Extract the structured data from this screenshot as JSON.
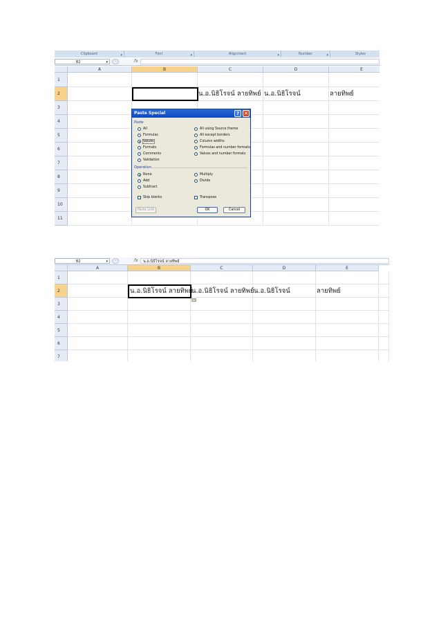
{
  "screenshot1": {
    "ribbon_groups": [
      {
        "label": "Clipboard",
        "launcher": "▾"
      },
      {
        "label": "Font",
        "launcher": "▾"
      },
      {
        "label": "Alignment",
        "launcher": "▾"
      },
      {
        "label": "Number",
        "launcher": "▾"
      },
      {
        "label": "Styles",
        "launcher": ""
      }
    ],
    "name_box": "B2",
    "formula": "",
    "columns": [
      "A",
      "B",
      "C",
      "D",
      "E"
    ],
    "rows": [
      "1",
      "2",
      "3",
      "4",
      "5",
      "6",
      "7",
      "8",
      "9",
      "10",
      "11"
    ],
    "cells": {
      "C2": "น.อ.นิธิโรจน์ ลายทิพย์",
      "D2": "น.อ.นิธิโรจน์",
      "E2": "ลายทิพย์"
    },
    "dialog": {
      "title": "Paste Special",
      "help": "?",
      "close": "✕",
      "paste_label": "Paste",
      "paste_left": [
        {
          "label": "All",
          "selected": false
        },
        {
          "label": "Formulas",
          "selected": false
        },
        {
          "label": "Values",
          "selected": true
        },
        {
          "label": "Formats",
          "selected": false
        },
        {
          "label": "Comments",
          "selected": false
        },
        {
          "label": "Validation",
          "selected": false
        }
      ],
      "paste_right": [
        {
          "label": "All using Source theme",
          "selected": false
        },
        {
          "label": "All except borders",
          "selected": false
        },
        {
          "label": "Column widths",
          "selected": false
        },
        {
          "label": "Formulas and number formats",
          "selected": false
        },
        {
          "label": "Values and number formats",
          "selected": false
        }
      ],
      "operation_label": "Operation",
      "operation_left": [
        {
          "label": "None",
          "selected": true
        },
        {
          "label": "Add",
          "selected": false
        },
        {
          "label": "Subtract",
          "selected": false
        }
      ],
      "operation_right": [
        {
          "label": "Multiply",
          "selected": false
        },
        {
          "label": "Divide",
          "selected": false
        }
      ],
      "skip_blanks": "Skip blanks",
      "transpose": "Transpose",
      "paste_link": "Paste Link",
      "ok": "OK",
      "cancel": "Cancel"
    }
  },
  "screenshot2": {
    "name_box": "B2",
    "formula": "น.อ.นิธิโรจน์ ลายทิพย์",
    "columns": [
      "A",
      "B",
      "C",
      "D",
      "E"
    ],
    "rows": [
      "1",
      "2",
      "3",
      "4",
      "5",
      "6",
      "7"
    ],
    "cells": {
      "B2": "น.อ.นิธิโรจน์ ลายทิพย์",
      "C2": "น.อ.นิธิโรจน์ ลายทิพย์",
      "D2": "น.อ.นิธิโรจน์",
      "E2": "ลายทิพย์"
    }
  },
  "colors": {
    "selected_header": "#f8d18b",
    "dialog_title": "#0c49c4",
    "dialog_bg": "#ebe9dc"
  }
}
